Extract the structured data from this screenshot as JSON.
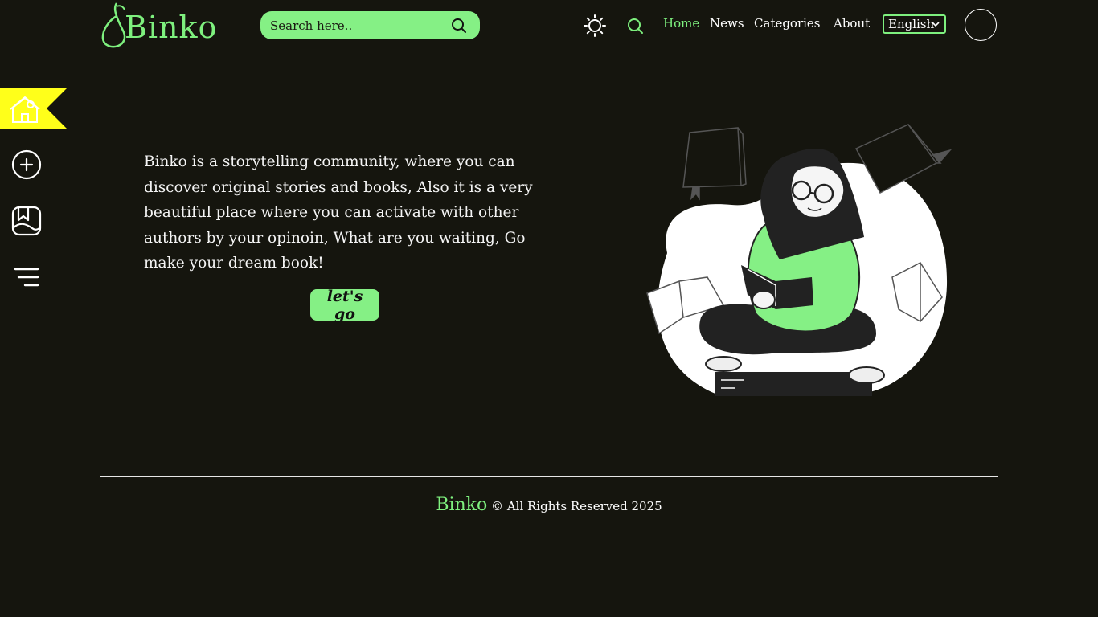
{
  "brand": {
    "name": "Binko"
  },
  "search": {
    "placeholder": "Search here.."
  },
  "nav": {
    "home": "Home",
    "news": "News",
    "categories": "Categories",
    "about": "About"
  },
  "language": {
    "selected": "English"
  },
  "hero": {
    "text": "Binko is a storytelling community, where you can discover original stories and books, Also it is a very beautiful place where you can activate with other authors by your opinoin, What are you waiting, Go make your dream book!",
    "cta": "let's go"
  },
  "footer": {
    "brand": "Binko",
    "copyright": "© All Rights Reserved 2025"
  },
  "colors": {
    "accent": "#85f085",
    "background": "#15150e",
    "highlight": "#ffff1a"
  },
  "icons": {
    "sidebar": [
      "home-icon",
      "add-circle-icon",
      "gallery-icon",
      "menu-icon"
    ],
    "header": [
      "sun-icon",
      "search-icon",
      "chevron-down-icon"
    ]
  }
}
